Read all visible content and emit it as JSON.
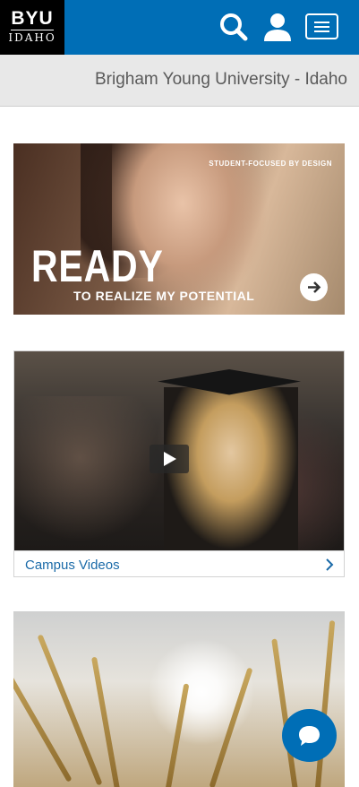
{
  "header": {
    "logo_top": "BYU",
    "logo_bottom": "IDAHO",
    "colors": {
      "bar": "#006eb6",
      "logo_bg": "#000000"
    },
    "icons": [
      "search-icon",
      "user-icon",
      "hamburger-menu-icon"
    ]
  },
  "title_bar": {
    "site_name": "Brigham Young University - Idaho"
  },
  "hero": {
    "tagline": "STUDENT-FOCUSED BY DESIGN",
    "headline": "READY",
    "subline": "TO REALIZE MY POTENTIAL",
    "icon": "arrow-right-icon"
  },
  "video_card": {
    "label": "Campus Videos",
    "icons": [
      "play-icon",
      "chevron-right-icon"
    ]
  },
  "chat": {
    "icon": "chat-bubble-icon",
    "color": "#006eb6"
  }
}
